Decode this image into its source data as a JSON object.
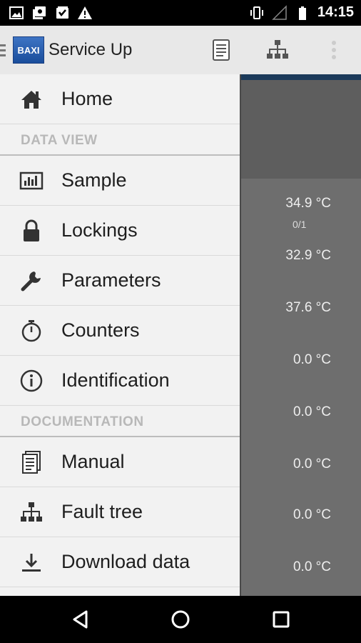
{
  "status_bar": {
    "time": "14:15",
    "left_icons": [
      "image-icon",
      "photo-album-icon",
      "download-icon",
      "warning-icon"
    ],
    "right_icons": [
      "vibrate-icon",
      "signal-icon",
      "battery-icon"
    ]
  },
  "app_bar": {
    "logo_text": "BAXI",
    "title": "Service Up",
    "actions": [
      "manual-icon",
      "fault-tree-icon",
      "overflow-menu-icon"
    ]
  },
  "drawer": {
    "home_label": "Home",
    "sections": [
      {
        "title": "DATA VIEW",
        "items": [
          {
            "label": "Sample",
            "icon": "chart-icon"
          },
          {
            "label": "Lockings",
            "icon": "lock-icon"
          },
          {
            "label": "Parameters",
            "icon": "wrench-icon"
          },
          {
            "label": "Counters",
            "icon": "stopwatch-icon"
          },
          {
            "label": "Identification",
            "icon": "info-icon"
          }
        ]
      },
      {
        "title": "DOCUMENTATION",
        "items": [
          {
            "label": "Manual",
            "icon": "document-icon"
          },
          {
            "label": "Fault tree",
            "icon": "fault-tree-icon"
          },
          {
            "label": "Download data",
            "icon": "download-icon"
          }
        ]
      }
    ]
  },
  "background": {
    "ratio": "0/1",
    "values": [
      "34.9 °C",
      "32.9 °C",
      "37.6 °C",
      "0.0 °C",
      "0.0 °C",
      "0.0 °C",
      "0.0 °C",
      "0.0 °C"
    ]
  },
  "colors": {
    "accent": "#1b3a5a",
    "drawer_bg": "#f2f2f2",
    "app_bar_bg": "#e8e8e8",
    "section_text": "#b8b8b8"
  }
}
